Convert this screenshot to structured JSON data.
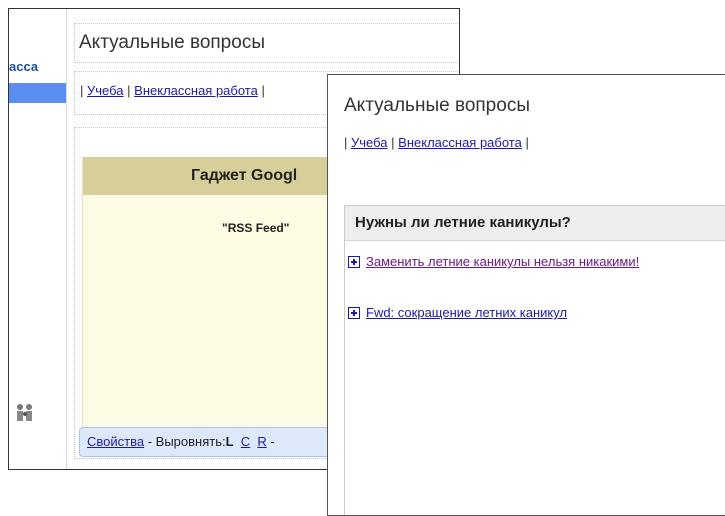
{
  "editor": {
    "sidebar_crumb": "асса",
    "people_icon": "people-icon",
    "title": "Актуальные вопросы",
    "links": {
      "sep": "|",
      "items": [
        "Учеба",
        "Внеклассная работа"
      ]
    },
    "gadget_header": "Гаджет Googl",
    "feed_label": "\"RSS Feed\"",
    "props_link": "Свойства",
    "props_text": " - Выровнять:",
    "align_options": [
      "L",
      "C",
      "R"
    ],
    "props_tail": " -"
  },
  "preview": {
    "title": "Актуальные вопросы",
    "links": [
      "Учеба",
      "Внеклассная работа"
    ],
    "sep": "|",
    "panel_header": "Нужны ли летние каникулы?",
    "items": [
      {
        "label": "Заменить летние каникулы нельзя никакими!",
        "visited": true
      },
      {
        "label": "Fwd: сокращение летних каникул",
        "visited": false
      }
    ],
    "colors": {
      "link": "#1a1aa6",
      "visited": "#6b1a8a",
      "header_bg": "#eeeeee"
    }
  }
}
